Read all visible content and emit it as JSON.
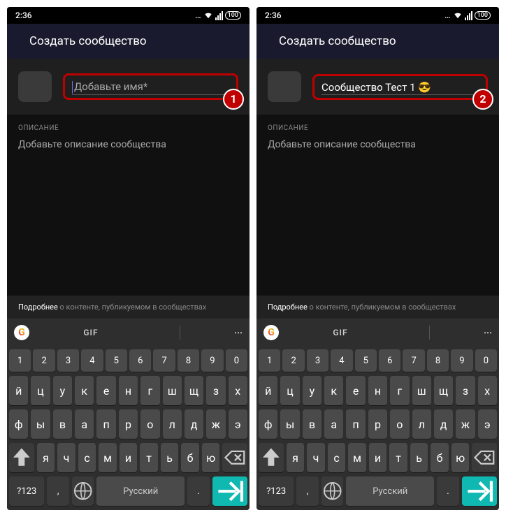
{
  "status": {
    "time": "2:36",
    "battery": "100"
  },
  "header": {
    "title": "Создать сообщество"
  },
  "screens": [
    {
      "name_placeholder": "Добавьте имя*",
      "name_value": "",
      "badge": "1",
      "show_check": false,
      "show_cursor": true
    },
    {
      "name_placeholder": "Добавьте имя*",
      "name_value": "Сообщество Тест 1 😎",
      "badge": "2",
      "show_check": true,
      "show_cursor": false
    }
  ],
  "description": {
    "label": "ОПИСАНИЕ",
    "placeholder": "Добавьте описание сообщества"
  },
  "footer": {
    "link": "Подробнее",
    "rest": " о контенте, публикуемом в сообществах"
  },
  "keyboard": {
    "toolbar": {
      "gif": "GIF"
    },
    "rows": {
      "numbers": [
        "1",
        "2",
        "3",
        "4",
        "5",
        "6",
        "7",
        "8",
        "9",
        "0"
      ],
      "r1": [
        "й",
        "ц",
        "у",
        "к",
        "е",
        "н",
        "г",
        "ш",
        "щ",
        "з",
        "х"
      ],
      "r2": [
        "ф",
        "ы",
        "в",
        "а",
        "п",
        "р",
        "о",
        "л",
        "д",
        "ж",
        "э"
      ],
      "r3": [
        "я",
        "ч",
        "с",
        "м",
        "и",
        "т",
        "ь",
        "б",
        "ю"
      ],
      "bottom": {
        "sym": "?123",
        "comma": ",",
        "space": "Русский",
        "period": "."
      }
    }
  }
}
